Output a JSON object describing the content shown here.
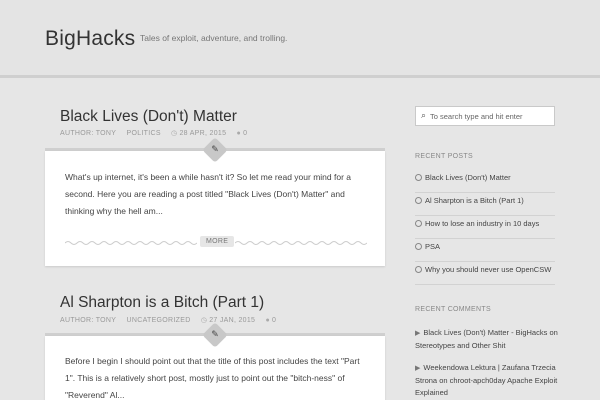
{
  "site": {
    "title": "BigHacks",
    "tagline": "Tales of exploit, adventure, and trolling."
  },
  "posts": [
    {
      "title": "Black Lives (Don't) Matter",
      "author": "AUTHOR: TONY",
      "category": "POLITICS",
      "date": "28 APR, 2015",
      "comments": "0",
      "excerpt_lines": [
        "What's up internet, it's been a while hasn't it? So let me read your mind for a",
        "second. Here you are reading a post titled \"Black Lives (Don't) Matter\" and",
        "thinking why the hell am..."
      ],
      "more_label": "MORE"
    },
    {
      "title": "Al Sharpton is a Bitch (Part 1)",
      "author": "AUTHOR: TONY",
      "category": "UNCATEGORIZED",
      "date": "27 JAN, 2015",
      "comments": "0",
      "excerpt_lines": [
        "Before I begin I should point out that the title of this post includes the text \"Part",
        "1\". This is a relatively short post, mostly just to point out the \"bitch-ness\" of",
        "\"Reverend\" Al..."
      ]
    }
  ],
  "sidebar": {
    "search_placeholder": "To search type and hit enter",
    "recent_posts_title": "RECENT POSTS",
    "recent_posts": [
      "Black Lives (Don't) Matter",
      "Al Sharpton is a Bitch (Part 1)",
      "How to lose an industry in 10 days",
      "PSA",
      "Why you should never use OpenCSW"
    ],
    "recent_comments_title": "RECENT COMMENTS",
    "recent_comments": [
      {
        "author": "Black Lives (Don't) Matter - BigHacks",
        "on": "on",
        "post": "Stereotypes and Other Shit"
      },
      {
        "author": "Weekendowa Lektura | Zaufana Trzecia Strona",
        "on": "on",
        "post": "chroot-apch0day Apache Exploit Explained"
      }
    ]
  },
  "icons": {
    "pencil": "✎",
    "calendar": "◷",
    "comment": "●",
    "search": "⌕",
    "bullet": "◯",
    "speech": "▶"
  }
}
